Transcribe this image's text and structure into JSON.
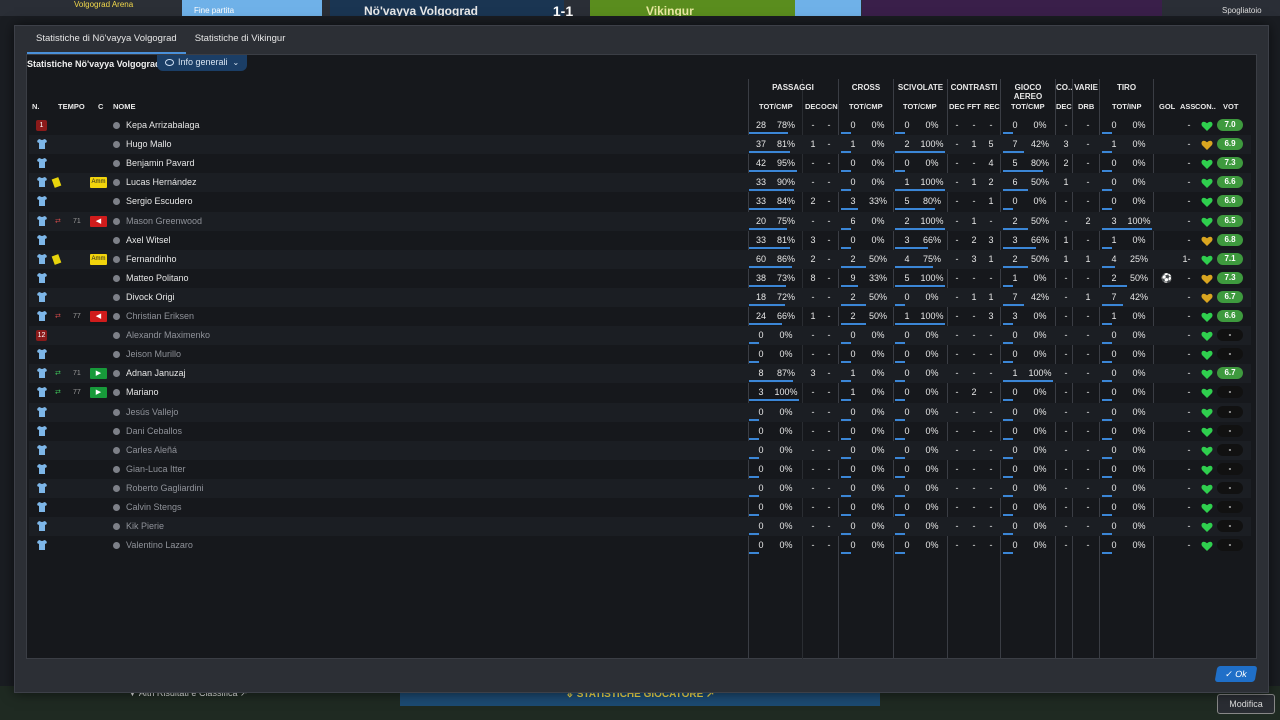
{
  "background": {
    "stadium": "Volgograd Arena",
    "status": "Fine partita",
    "home_team": "Nö'vayya Volgograd",
    "away_team": "Vikingur",
    "score": "1-1",
    "top_right": "Spogliatoio",
    "bottom_left": "Altri Risultati e Classifica",
    "bottom_center": "STATISTICHE GIOCATORE",
    "bottom_right": "Modifica"
  },
  "modal": {
    "tabs": [
      "Statistiche di Nö'vayya Volgograd",
      "Statistiche di Vikingur"
    ],
    "panel_title": "Statistiche Nö'vayya Volgograd",
    "view_dropdown": "Info generali",
    "ok_label": "Ok"
  },
  "groups": {
    "passaggi": "PASSAGGI",
    "cross": "CROSS",
    "scivolate": "SCIVOLATE",
    "contrasti": "CONTRASTI",
    "gioco_aereo": "GIOCO AEREO",
    "co": "CO..",
    "varie": "VARIE",
    "tiro": "TIRO"
  },
  "columns": {
    "n": "N.",
    "tempo": "TEMPO",
    "c": "C",
    "nome": "NOME",
    "pass_totcmp": "TOT/CMP",
    "pass_dec": "DEC",
    "pass_ocn": "OCN",
    "cross_totcmp": "TOT/CMP",
    "sciv_totcmp": "TOT/CMP",
    "contr_dec": "DEC",
    "contr_fft": "FFT",
    "contr_rec": "REC",
    "aereo_totcmp": "TOT/CMP",
    "co_dec": "DEC",
    "varie_drb": "DRB",
    "tiro_totinp": "TOT/INP",
    "gol": "GOL",
    "ass": "ASS",
    "con": "CON..",
    "vot": "VOT"
  },
  "players": [
    {
      "num": "1",
      "keeper": true,
      "name": "Kepa Arrizabalaga",
      "dim": false,
      "card": "",
      "sub": "",
      "subtime": "",
      "c": "",
      "pass": [
        "28",
        "78%"
      ],
      "pass_fill": 0.78,
      "pdec": "-",
      "pocn": "-",
      "cross": [
        "0",
        "0%"
      ],
      "cross_fill": 0,
      "sciv": [
        "0",
        "0%"
      ],
      "sciv_fill": 0,
      "cdec": "-",
      "cfft": "-",
      "crec": "-",
      "aereo": [
        "0",
        "0%"
      ],
      "aereo_fill": 0,
      "codec": "-",
      "drb": "-",
      "tiro": [
        "0",
        "0%"
      ],
      "tiro_fill": 0,
      "gol": "",
      "ass": "-",
      "vote": "7.0",
      "cond": "green"
    },
    {
      "num": "",
      "keeper": false,
      "name": "Hugo Mallo",
      "dim": false,
      "card": "",
      "sub": "",
      "subtime": "",
      "c": "",
      "pass": [
        "37",
        "81%"
      ],
      "pass_fill": 0.81,
      "pdec": "1",
      "pocn": "-",
      "cross": [
        "1",
        "0%"
      ],
      "cross_fill": 0,
      "sciv": [
        "2",
        "100%"
      ],
      "sciv_fill": 1,
      "cdec": "-",
      "cfft": "1",
      "crec": "5",
      "aereo": [
        "7",
        "42%"
      ],
      "aereo_fill": 0.42,
      "codec": "3",
      "drb": "-",
      "tiro": [
        "1",
        "0%"
      ],
      "tiro_fill": 0,
      "gol": "",
      "ass": "-",
      "vote": "6.9",
      "cond": "gold"
    },
    {
      "num": "",
      "keeper": false,
      "name": "Benjamin Pavard",
      "dim": false,
      "card": "",
      "sub": "",
      "subtime": "",
      "c": "",
      "pass": [
        "42",
        "95%"
      ],
      "pass_fill": 0.95,
      "pdec": "-",
      "pocn": "-",
      "cross": [
        "0",
        "0%"
      ],
      "cross_fill": 0,
      "sciv": [
        "0",
        "0%"
      ],
      "sciv_fill": 0,
      "cdec": "-",
      "cfft": "-",
      "crec": "4",
      "aereo": [
        "5",
        "80%"
      ],
      "aereo_fill": 0.8,
      "codec": "2",
      "drb": "-",
      "tiro": [
        "0",
        "0%"
      ],
      "tiro_fill": 0,
      "gol": "",
      "ass": "-",
      "vote": "7.3",
      "cond": "green"
    },
    {
      "num": "",
      "keeper": false,
      "name": "Lucas Hernández",
      "dim": false,
      "card": "yellow",
      "sub": "",
      "subtime": "",
      "c": "Amm",
      "pass": [
        "33",
        "90%"
      ],
      "pass_fill": 0.9,
      "pdec": "-",
      "pocn": "-",
      "cross": [
        "0",
        "0%"
      ],
      "cross_fill": 0,
      "sciv": [
        "1",
        "100%"
      ],
      "sciv_fill": 1,
      "cdec": "-",
      "cfft": "1",
      "crec": "2",
      "aereo": [
        "6",
        "50%"
      ],
      "aereo_fill": 0.5,
      "codec": "1",
      "drb": "-",
      "tiro": [
        "0",
        "0%"
      ],
      "tiro_fill": 0,
      "gol": "",
      "ass": "-",
      "vote": "6.6",
      "cond": "green"
    },
    {
      "num": "",
      "keeper": false,
      "name": "Sergio Escudero",
      "dim": false,
      "card": "",
      "sub": "",
      "subtime": "",
      "c": "",
      "pass": [
        "33",
        "84%"
      ],
      "pass_fill": 0.84,
      "pdec": "2",
      "pocn": "-",
      "cross": [
        "3",
        "33%"
      ],
      "cross_fill": 0.33,
      "sciv": [
        "5",
        "80%"
      ],
      "sciv_fill": 0.8,
      "cdec": "-",
      "cfft": "-",
      "crec": "1",
      "aereo": [
        "0",
        "0%"
      ],
      "aereo_fill": 0,
      "codec": "-",
      "drb": "-",
      "tiro": [
        "0",
        "0%"
      ],
      "tiro_fill": 0,
      "gol": "",
      "ass": "-",
      "vote": "6.6",
      "cond": "green"
    },
    {
      "num": "",
      "keeper": false,
      "name": "Mason Greenwood",
      "dim": true,
      "card": "",
      "sub": "off",
      "subtime": "71",
      "c": "out",
      "pass": [
        "20",
        "75%"
      ],
      "pass_fill": 0.75,
      "pdec": "-",
      "pocn": "-",
      "cross": [
        "6",
        "0%"
      ],
      "cross_fill": 0,
      "sciv": [
        "2",
        "100%"
      ],
      "sciv_fill": 1,
      "cdec": "-",
      "cfft": "1",
      "crec": "-",
      "aereo": [
        "2",
        "50%"
      ],
      "aereo_fill": 0.5,
      "codec": "-",
      "drb": "2",
      "tiro": [
        "3",
        "100%"
      ],
      "tiro_fill": 1,
      "gol": "",
      "ass": "-",
      "vote": "6.5",
      "cond": "green"
    },
    {
      "num": "",
      "keeper": false,
      "name": "Axel Witsel",
      "dim": false,
      "card": "",
      "sub": "",
      "subtime": "",
      "c": "",
      "pass": [
        "33",
        "81%"
      ],
      "pass_fill": 0.81,
      "pdec": "3",
      "pocn": "-",
      "cross": [
        "0",
        "0%"
      ],
      "cross_fill": 0,
      "sciv": [
        "3",
        "66%"
      ],
      "sciv_fill": 0.66,
      "cdec": "-",
      "cfft": "2",
      "crec": "3",
      "aereo": [
        "3",
        "66%"
      ],
      "aereo_fill": 0.66,
      "codec": "1",
      "drb": "-",
      "tiro": [
        "1",
        "0%"
      ],
      "tiro_fill": 0,
      "gol": "",
      "ass": "-",
      "vote": "6.8",
      "cond": "gold"
    },
    {
      "num": "",
      "keeper": false,
      "name": "Fernandinho",
      "dim": false,
      "card": "yellow",
      "sub": "",
      "subtime": "",
      "c": "Amm",
      "pass": [
        "60",
        "86%"
      ],
      "pass_fill": 0.86,
      "pdec": "2",
      "pocn": "-",
      "cross": [
        "2",
        "50%"
      ],
      "cross_fill": 0.5,
      "sciv": [
        "4",
        "75%"
      ],
      "sciv_fill": 0.75,
      "cdec": "-",
      "cfft": "3",
      "crec": "1",
      "aereo": [
        "2",
        "50%"
      ],
      "aereo_fill": 0.5,
      "codec": "1",
      "drb": "1",
      "tiro": [
        "4",
        "25%"
      ],
      "tiro_fill": 0.25,
      "gol": "1",
      "ass": "-",
      "vote": "7.1",
      "cond": "green"
    },
    {
      "num": "",
      "keeper": false,
      "name": "Matteo Politano",
      "dim": false,
      "card": "",
      "sub": "",
      "subtime": "",
      "c": "",
      "pass": [
        "38",
        "73%"
      ],
      "pass_fill": 0.73,
      "pdec": "8",
      "pocn": "-",
      "cross": [
        "9",
        "33%"
      ],
      "cross_fill": 0.33,
      "sciv": [
        "5",
        "100%"
      ],
      "sciv_fill": 1,
      "cdec": "-",
      "cfft": "-",
      "crec": "-",
      "aereo": [
        "1",
        "0%"
      ],
      "aereo_fill": 0,
      "codec": "-",
      "drb": "-",
      "tiro": [
        "2",
        "50%"
      ],
      "tiro_fill": 0.5,
      "gol": "ball",
      "ass": "-",
      "vote": "7.3",
      "cond": "gold"
    },
    {
      "num": "",
      "keeper": false,
      "name": "Divock Origi",
      "dim": false,
      "card": "",
      "sub": "",
      "subtime": "",
      "c": "",
      "pass": [
        "18",
        "72%"
      ],
      "pass_fill": 0.72,
      "pdec": "-",
      "pocn": "-",
      "cross": [
        "2",
        "50%"
      ],
      "cross_fill": 0.5,
      "sciv": [
        "0",
        "0%"
      ],
      "sciv_fill": 0,
      "cdec": "-",
      "cfft": "1",
      "crec": "1",
      "aereo": [
        "7",
        "42%"
      ],
      "aereo_fill": 0.42,
      "codec": "-",
      "drb": "1",
      "tiro": [
        "7",
        "42%"
      ],
      "tiro_fill": 0.42,
      "gol": "",
      "ass": "-",
      "vote": "6.7",
      "cond": "gold"
    },
    {
      "num": "",
      "keeper": false,
      "name": "Christian Eriksen",
      "dim": true,
      "card": "",
      "sub": "off",
      "subtime": "77",
      "c": "out",
      "pass": [
        "24",
        "66%"
      ],
      "pass_fill": 0.66,
      "pdec": "1",
      "pocn": "-",
      "cross": [
        "2",
        "50%"
      ],
      "cross_fill": 0.5,
      "sciv": [
        "1",
        "100%"
      ],
      "sciv_fill": 1,
      "cdec": "-",
      "cfft": "-",
      "crec": "3",
      "aereo": [
        "3",
        "0%"
      ],
      "aereo_fill": 0,
      "codec": "-",
      "drb": "-",
      "tiro": [
        "1",
        "0%"
      ],
      "tiro_fill": 0,
      "gol": "",
      "ass": "-",
      "vote": "6.6",
      "cond": "green"
    },
    {
      "num": "12",
      "keeper": true,
      "name": "Alexandr Maximenko",
      "dim": true,
      "card": "",
      "sub": "",
      "subtime": "",
      "c": "",
      "pass": [
        "0",
        "0%"
      ],
      "pass_fill": 0,
      "pdec": "-",
      "pocn": "-",
      "cross": [
        "0",
        "0%"
      ],
      "cross_fill": 0,
      "sciv": [
        "0",
        "0%"
      ],
      "sciv_fill": 0,
      "cdec": "-",
      "cfft": "-",
      "crec": "-",
      "aereo": [
        "0",
        "0%"
      ],
      "aereo_fill": 0,
      "codec": "-",
      "drb": "-",
      "tiro": [
        "0",
        "0%"
      ],
      "tiro_fill": 0,
      "gol": "",
      "ass": "-",
      "vote": "-",
      "cond": "green"
    },
    {
      "num": "",
      "keeper": false,
      "name": "Jeison Murillo",
      "dim": true,
      "card": "",
      "sub": "",
      "subtime": "",
      "c": "",
      "pass": [
        "0",
        "0%"
      ],
      "pass_fill": 0,
      "pdec": "-",
      "pocn": "-",
      "cross": [
        "0",
        "0%"
      ],
      "cross_fill": 0,
      "sciv": [
        "0",
        "0%"
      ],
      "sciv_fill": 0,
      "cdec": "-",
      "cfft": "-",
      "crec": "-",
      "aereo": [
        "0",
        "0%"
      ],
      "aereo_fill": 0,
      "codec": "-",
      "drb": "-",
      "tiro": [
        "0",
        "0%"
      ],
      "tiro_fill": 0,
      "gol": "",
      "ass": "-",
      "vote": "-",
      "cond": "green"
    },
    {
      "num": "",
      "keeper": false,
      "name": "Adnan Januzaj",
      "dim": false,
      "card": "",
      "sub": "on",
      "subtime": "71",
      "c": "in",
      "pass": [
        "8",
        "87%"
      ],
      "pass_fill": 0.87,
      "pdec": "3",
      "pocn": "-",
      "cross": [
        "1",
        "0%"
      ],
      "cross_fill": 0,
      "sciv": [
        "0",
        "0%"
      ],
      "sciv_fill": 0,
      "cdec": "-",
      "cfft": "-",
      "crec": "-",
      "aereo": [
        "1",
        "100%"
      ],
      "aereo_fill": 1,
      "codec": "-",
      "drb": "-",
      "tiro": [
        "0",
        "0%"
      ],
      "tiro_fill": 0,
      "gol": "",
      "ass": "-",
      "vote": "6.7",
      "cond": "green"
    },
    {
      "num": "",
      "keeper": false,
      "name": "Mariano",
      "dim": false,
      "card": "",
      "sub": "on",
      "subtime": "77",
      "c": "in",
      "pass": [
        "3",
        "100%"
      ],
      "pass_fill": 1,
      "pdec": "-",
      "pocn": "-",
      "cross": [
        "1",
        "0%"
      ],
      "cross_fill": 0,
      "sciv": [
        "0",
        "0%"
      ],
      "sciv_fill": 0,
      "cdec": "-",
      "cfft": "2",
      "crec": "-",
      "aereo": [
        "0",
        "0%"
      ],
      "aereo_fill": 0,
      "codec": "-",
      "drb": "-",
      "tiro": [
        "0",
        "0%"
      ],
      "tiro_fill": 0,
      "gol": "",
      "ass": "-",
      "vote": "-",
      "cond": "green"
    },
    {
      "num": "",
      "keeper": false,
      "name": "Jesús Vallejo",
      "dim": true,
      "card": "",
      "sub": "",
      "subtime": "",
      "c": "",
      "pass": [
        "0",
        "0%"
      ],
      "pass_fill": 0,
      "pdec": "-",
      "pocn": "-",
      "cross": [
        "0",
        "0%"
      ],
      "cross_fill": 0,
      "sciv": [
        "0",
        "0%"
      ],
      "sciv_fill": 0,
      "cdec": "-",
      "cfft": "-",
      "crec": "-",
      "aereo": [
        "0",
        "0%"
      ],
      "aereo_fill": 0,
      "codec": "-",
      "drb": "-",
      "tiro": [
        "0",
        "0%"
      ],
      "tiro_fill": 0,
      "gol": "",
      "ass": "-",
      "vote": "-",
      "cond": "green"
    },
    {
      "num": "",
      "keeper": false,
      "name": "Dani Ceballos",
      "dim": true,
      "card": "",
      "sub": "",
      "subtime": "",
      "c": "",
      "pass": [
        "0",
        "0%"
      ],
      "pass_fill": 0,
      "pdec": "-",
      "pocn": "-",
      "cross": [
        "0",
        "0%"
      ],
      "cross_fill": 0,
      "sciv": [
        "0",
        "0%"
      ],
      "sciv_fill": 0,
      "cdec": "-",
      "cfft": "-",
      "crec": "-",
      "aereo": [
        "0",
        "0%"
      ],
      "aereo_fill": 0,
      "codec": "-",
      "drb": "-",
      "tiro": [
        "0",
        "0%"
      ],
      "tiro_fill": 0,
      "gol": "",
      "ass": "-",
      "vote": "-",
      "cond": "green"
    },
    {
      "num": "",
      "keeper": false,
      "name": "Carles Aleñá",
      "dim": true,
      "card": "",
      "sub": "",
      "subtime": "",
      "c": "",
      "pass": [
        "0",
        "0%"
      ],
      "pass_fill": 0,
      "pdec": "-",
      "pocn": "-",
      "cross": [
        "0",
        "0%"
      ],
      "cross_fill": 0,
      "sciv": [
        "0",
        "0%"
      ],
      "sciv_fill": 0,
      "cdec": "-",
      "cfft": "-",
      "crec": "-",
      "aereo": [
        "0",
        "0%"
      ],
      "aereo_fill": 0,
      "codec": "-",
      "drb": "-",
      "tiro": [
        "0",
        "0%"
      ],
      "tiro_fill": 0,
      "gol": "",
      "ass": "-",
      "vote": "-",
      "cond": "green"
    },
    {
      "num": "",
      "keeper": false,
      "name": "Gian-Luca Itter",
      "dim": true,
      "card": "",
      "sub": "",
      "subtime": "",
      "c": "",
      "pass": [
        "0",
        "0%"
      ],
      "pass_fill": 0,
      "pdec": "-",
      "pocn": "-",
      "cross": [
        "0",
        "0%"
      ],
      "cross_fill": 0,
      "sciv": [
        "0",
        "0%"
      ],
      "sciv_fill": 0,
      "cdec": "-",
      "cfft": "-",
      "crec": "-",
      "aereo": [
        "0",
        "0%"
      ],
      "aereo_fill": 0,
      "codec": "-",
      "drb": "-",
      "tiro": [
        "0",
        "0%"
      ],
      "tiro_fill": 0,
      "gol": "",
      "ass": "-",
      "vote": "-",
      "cond": "green"
    },
    {
      "num": "",
      "keeper": false,
      "name": "Roberto Gagliardini",
      "dim": true,
      "card": "",
      "sub": "",
      "subtime": "",
      "c": "",
      "pass": [
        "0",
        "0%"
      ],
      "pass_fill": 0,
      "pdec": "-",
      "pocn": "-",
      "cross": [
        "0",
        "0%"
      ],
      "cross_fill": 0,
      "sciv": [
        "0",
        "0%"
      ],
      "sciv_fill": 0,
      "cdec": "-",
      "cfft": "-",
      "crec": "-",
      "aereo": [
        "0",
        "0%"
      ],
      "aereo_fill": 0,
      "codec": "-",
      "drb": "-",
      "tiro": [
        "0",
        "0%"
      ],
      "tiro_fill": 0,
      "gol": "",
      "ass": "-",
      "vote": "-",
      "cond": "green"
    },
    {
      "num": "",
      "keeper": false,
      "name": "Calvin Stengs",
      "dim": true,
      "card": "",
      "sub": "",
      "subtime": "",
      "c": "",
      "pass": [
        "0",
        "0%"
      ],
      "pass_fill": 0,
      "pdec": "-",
      "pocn": "-",
      "cross": [
        "0",
        "0%"
      ],
      "cross_fill": 0,
      "sciv": [
        "0",
        "0%"
      ],
      "sciv_fill": 0,
      "cdec": "-",
      "cfft": "-",
      "crec": "-",
      "aereo": [
        "0",
        "0%"
      ],
      "aereo_fill": 0,
      "codec": "-",
      "drb": "-",
      "tiro": [
        "0",
        "0%"
      ],
      "tiro_fill": 0,
      "gol": "",
      "ass": "-",
      "vote": "-",
      "cond": "green"
    },
    {
      "num": "",
      "keeper": false,
      "name": "Kik Pierie",
      "dim": true,
      "card": "",
      "sub": "",
      "subtime": "",
      "c": "",
      "pass": [
        "0",
        "0%"
      ],
      "pass_fill": 0,
      "pdec": "-",
      "pocn": "-",
      "cross": [
        "0",
        "0%"
      ],
      "cross_fill": 0,
      "sciv": [
        "0",
        "0%"
      ],
      "sciv_fill": 0,
      "cdec": "-",
      "cfft": "-",
      "crec": "-",
      "aereo": [
        "0",
        "0%"
      ],
      "aereo_fill": 0,
      "codec": "-",
      "drb": "-",
      "tiro": [
        "0",
        "0%"
      ],
      "tiro_fill": 0,
      "gol": "",
      "ass": "-",
      "vote": "-",
      "cond": "green"
    },
    {
      "num": "",
      "keeper": false,
      "name": "Valentino Lazaro",
      "dim": true,
      "card": "",
      "sub": "",
      "subtime": "",
      "c": "",
      "pass": [
        "0",
        "0%"
      ],
      "pass_fill": 0,
      "pdec": "-",
      "pocn": "-",
      "cross": [
        "0",
        "0%"
      ],
      "cross_fill": 0,
      "sciv": [
        "0",
        "0%"
      ],
      "sciv_fill": 0,
      "cdec": "-",
      "cfft": "-",
      "crec": "-",
      "aereo": [
        "0",
        "0%"
      ],
      "aereo_fill": 0,
      "codec": "-",
      "drb": "-",
      "tiro": [
        "0",
        "0%"
      ],
      "tiro_fill": 0,
      "gol": "",
      "ass": "-",
      "vote": "-",
      "cond": "green"
    }
  ],
  "colors": {
    "accent": "#3b86d6",
    "shirt": "#7db6e8",
    "keeper": "#8b1a1a",
    "heart_green": "#2fcf4e",
    "heart_gold": "#d9a520",
    "vote_green": "#3e9a3e"
  }
}
